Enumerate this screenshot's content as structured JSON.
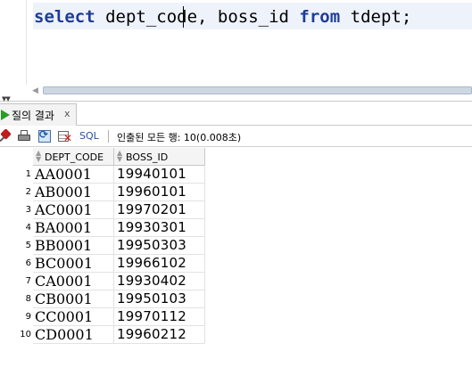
{
  "editor": {
    "keyword_select": "select",
    "columns": " dept_code, boss_id ",
    "keyword_from": "from",
    "table": " tdept;"
  },
  "results_tab": {
    "label": "질의 결과",
    "close_label": "x"
  },
  "toolbar": {
    "sql_label": "SQL",
    "status": "인출된 모든 행: 10(0.008초)"
  },
  "table": {
    "columns": [
      "DEPT_CODE",
      "BOSS_ID"
    ],
    "rows": [
      {
        "num": "1",
        "dept_code": "AA0001",
        "boss_id": "19940101"
      },
      {
        "num": "2",
        "dept_code": "AB0001",
        "boss_id": "19960101"
      },
      {
        "num": "3",
        "dept_code": "AC0001",
        "boss_id": "19970201"
      },
      {
        "num": "4",
        "dept_code": "BA0001",
        "boss_id": "19930301"
      },
      {
        "num": "5",
        "dept_code": "BB0001",
        "boss_id": "19950303"
      },
      {
        "num": "6",
        "dept_code": "BC0001",
        "boss_id": "19966102"
      },
      {
        "num": "7",
        "dept_code": "CA0001",
        "boss_id": "19930402"
      },
      {
        "num": "8",
        "dept_code": "CB0001",
        "boss_id": "19950103"
      },
      {
        "num": "9",
        "dept_code": "CC0001",
        "boss_id": "19970112"
      },
      {
        "num": "10",
        "dept_code": "CD0001",
        "boss_id": "19960212"
      }
    ]
  }
}
